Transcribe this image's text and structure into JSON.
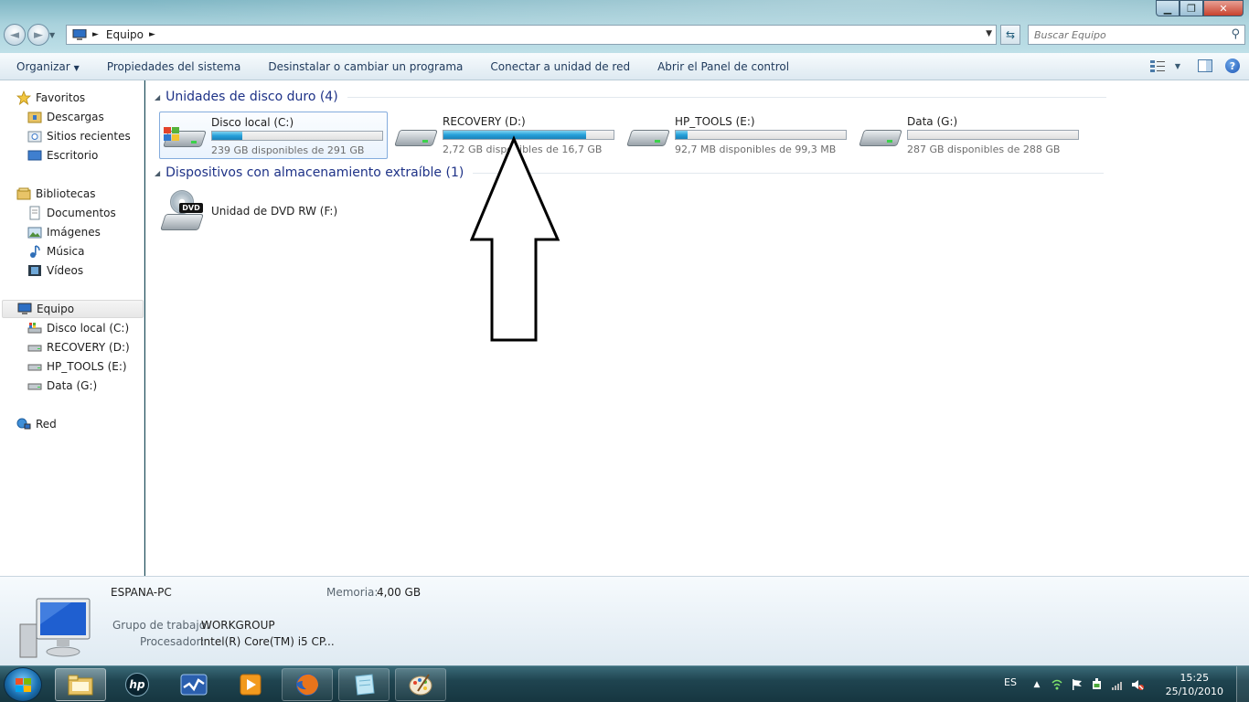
{
  "window": {
    "minimize": "▁",
    "maximize": "❐",
    "close": "✕"
  },
  "address": {
    "crumb": "Equipo",
    "search_placeholder": "Buscar Equipo"
  },
  "toolbar": {
    "items": [
      "Organizar",
      "Propiedades del sistema",
      "Desinstalar o cambiar un programa",
      "Conectar a unidad de red",
      "Abrir el Panel de control"
    ],
    "help": "?"
  },
  "nav": {
    "favorites": "Favoritos",
    "downloads": "Descargas",
    "recent": "Sitios recientes",
    "desktop": "Escritorio",
    "libraries": "Bibliotecas",
    "documents": "Documentos",
    "images": "Imágenes",
    "music": "Música",
    "videos": "Vídeos",
    "computer": "Equipo",
    "drive_c": "Disco local (C:)",
    "drive_d": "RECOVERY (D:)",
    "drive_e": "HP_TOOLS (E:)",
    "drive_g": "Data (G:)",
    "network": "Red"
  },
  "groups": {
    "hard_drives": "Unidades de disco duro (4)",
    "removable": "Dispositivos con almacenamiento extraíble (1)"
  },
  "drives": [
    {
      "name": "Disco local (C:)",
      "free": "239 GB disponibles de 291 GB",
      "used_fraction": 0.18
    },
    {
      "name": "RECOVERY (D:)",
      "free": "2,72 GB disponibles de 16,7 GB",
      "used_fraction": 0.84
    },
    {
      "name": "HP_TOOLS (E:)",
      "free": "92,7 MB disponibles de 99,3 MB",
      "used_fraction": 0.07
    },
    {
      "name": "Data (G:)",
      "free": "287 GB disponibles de 288 GB",
      "used_fraction": 0.0
    }
  ],
  "dvd": {
    "label": "DVD",
    "name": "Unidad de DVD RW (F:)"
  },
  "details": {
    "pc_name": "ESPANA-PC",
    "memory_label": "Memoria:",
    "memory_value": "4,00 GB",
    "workgroup_label": "Grupo de trabajo:",
    "workgroup_value": "WORKGROUP",
    "cpu_label": "Procesador:",
    "cpu_value": "Intel(R) Core(TM) i5 CP..."
  },
  "taskbar": {
    "lang": "ES",
    "time": "15:25",
    "date": "25/10/2010",
    "hp_label": "hp"
  },
  "colors": {
    "accent_blue": "#26a0da",
    "group_header": "#1e3287"
  }
}
